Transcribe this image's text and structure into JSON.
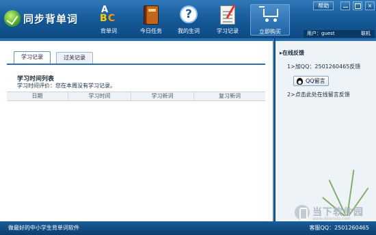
{
  "app": {
    "title": "同步背单词"
  },
  "toolbar": {
    "items": [
      {
        "label": "背单词",
        "icon": "abc-icon"
      },
      {
        "label": "今日任务",
        "icon": "book-icon"
      },
      {
        "label": "我的生词",
        "icon": "help-circle-icon"
      },
      {
        "label": "学习记录",
        "icon": "notepad-icon"
      },
      {
        "label": "立即购买",
        "icon": "cart-icon"
      }
    ],
    "abc": {
      "a": "A",
      "b": "B",
      "c": "C"
    },
    "help_glyph": "?"
  },
  "window": {
    "help_label": "帮助",
    "min": "",
    "max": "",
    "close": "×"
  },
  "user": {
    "label": "用户：guest",
    "connect": "联机"
  },
  "left": {
    "tabs": [
      "学习记录",
      "过关记录"
    ],
    "study_title": "学习时间列表",
    "study_eval": "学习时间评价：您在本周没有学习记录。",
    "columns": [
      "日期",
      "学习时间",
      "学习新词",
      "复习新词"
    ]
  },
  "right": {
    "title": "▸在线反馈",
    "qq_line": "1>加QQ：2501260465反馈",
    "qq_button": "QQ留言",
    "msg_line": "2>点击此处在线留言反馈"
  },
  "watermark": {
    "text": "当下软件园",
    "sub": "www.downxia.com"
  },
  "status": {
    "left": "做最好的中小学生背单词软件",
    "right": "客服QQ：2501260465"
  },
  "colors": {
    "title_bar": "#175b99",
    "accent": "#2f6ea8",
    "panel_bg": "#eef3f7"
  }
}
